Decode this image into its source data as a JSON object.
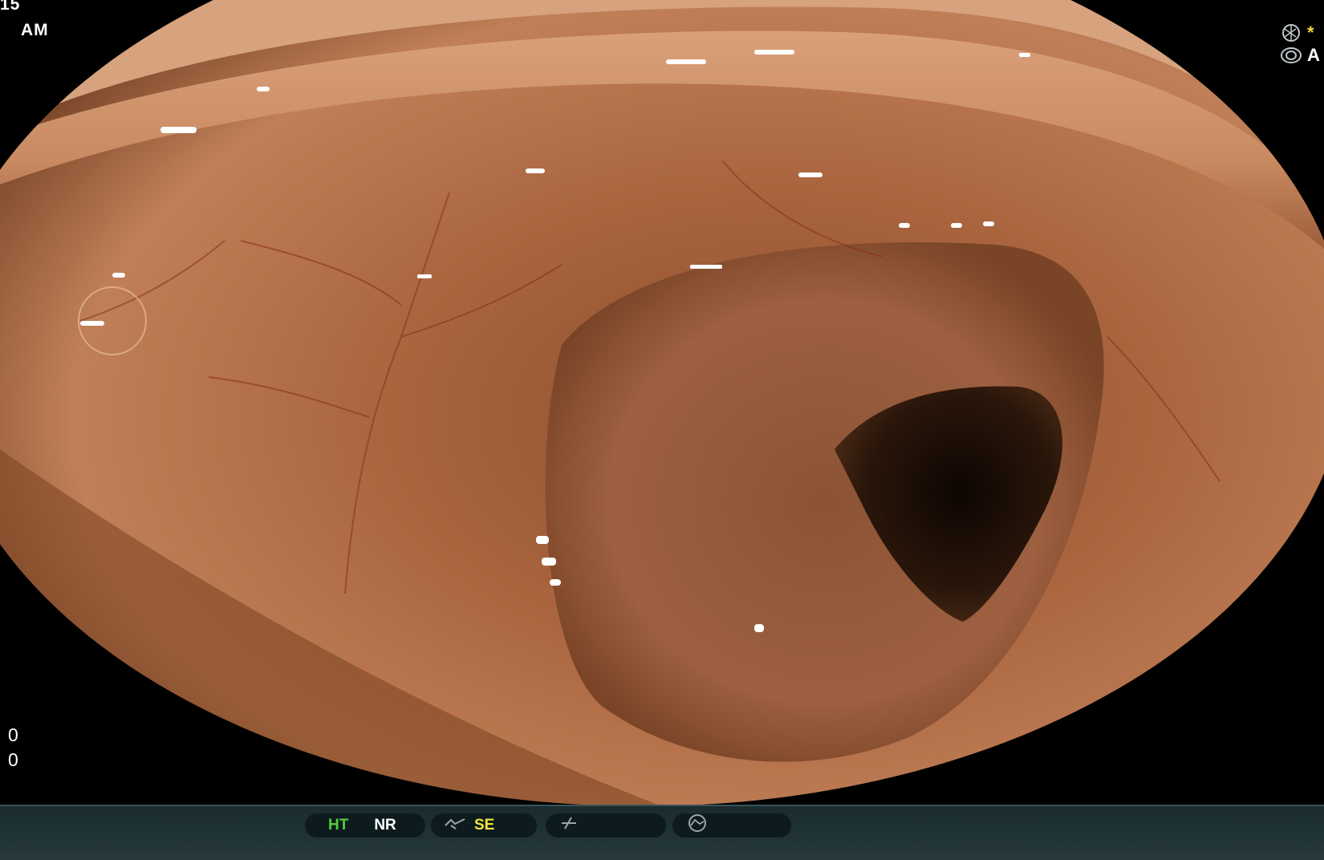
{
  "overlay": {
    "time_fragment": "15",
    "am_pm": "AM",
    "bottom_left_top": "0",
    "bottom_left_bottom": "0",
    "right_row1_text": "*",
    "right_row2_text": "A"
  },
  "status_bar": {
    "ht_label": "HT",
    "nr_label": "NR",
    "se_label": "SE"
  },
  "icons": {
    "right_row1": "shutter-icon",
    "right_row2": "iris-icon",
    "enhance": "structure-enhance-icon",
    "freeze": "freeze-icon",
    "record": "record-icon"
  },
  "colors": {
    "mucosa": "#b8714a",
    "lumen_dark": "#1e0d05",
    "ht_green": "#4fcf3c",
    "se_yellow": "#f2e43a",
    "bar_bg": "#1f3236"
  }
}
